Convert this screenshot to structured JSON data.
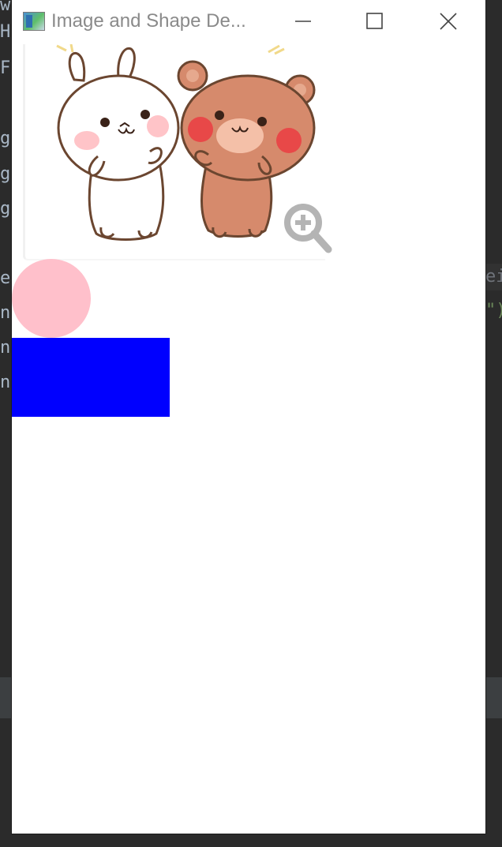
{
  "window": {
    "title": "Image and Shape De...",
    "icon": "app-window-icon",
    "controls": {
      "minimize": "minimize-icon",
      "maximize": "maximize-icon",
      "close": "close-icon"
    }
  },
  "content": {
    "image": {
      "subject": "cartoon bunny and bear",
      "overlay_icon": "zoom-in-icon"
    },
    "circle": {
      "color": "#ffc0cb"
    },
    "rectangle": {
      "color": "#0000ff"
    }
  },
  "background": {
    "left_fragments": [
      "w",
      "H",
      "F",
      "g",
      "g",
      "g",
      "e",
      "n",
      "n",
      "n"
    ],
    "right_fragments": [
      "eig",
      "\")"
    ]
  }
}
